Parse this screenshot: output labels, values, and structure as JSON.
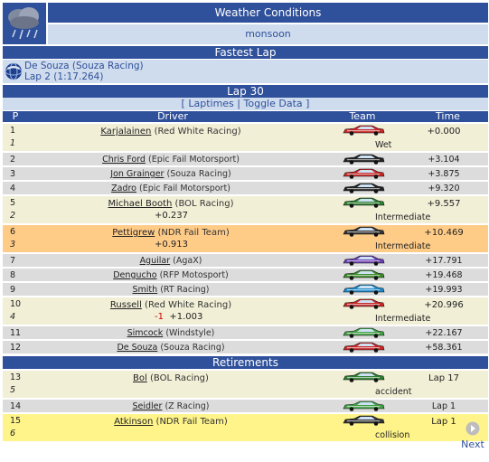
{
  "weather": {
    "title": "Weather Conditions",
    "value": "monsoon",
    "icon": "weather-cloud-rain-icon"
  },
  "fastest_lap": {
    "title": "Fastest Lap",
    "driver_line": "De Souza (Souza Racing)",
    "lap_line": "Lap 2 (1:17.264)",
    "icon": "globe-icon"
  },
  "lap": {
    "title": "Lap 30",
    "link_open": "[",
    "laptimes_label": "Laptimes",
    "separator": "|",
    "toggle_label": "Toggle Data",
    "link_close": "]"
  },
  "columns": {
    "p": "P",
    "driver": "Driver",
    "team": "Team",
    "time": "Time"
  },
  "standings": [
    {
      "pos": "1",
      "grid": "1",
      "driver": "Karjalainen",
      "team": "(Red White Racing)",
      "gain": "",
      "time": "+0.000",
      "cond": "Wet",
      "bg": "#f1efd6",
      "car": "#c62828"
    },
    {
      "pos": "2",
      "grid": "",
      "driver": "Chris Ford",
      "team": "(Epic Fail Motorsport)",
      "gain": "",
      "time": "+3.104",
      "cond": "",
      "bg": "#dcdcdc",
      "car": "#222222"
    },
    {
      "pos": "3",
      "grid": "",
      "driver": "Jon Grainger",
      "team": "(Souza Racing)",
      "gain": "",
      "time": "+3.875",
      "cond": "",
      "bg": "#dcdcdc",
      "car": "#c62828"
    },
    {
      "pos": "4",
      "grid": "",
      "driver": "Zadro",
      "team": "(Epic Fail Motorsport)",
      "gain": "",
      "time": "+9.320",
      "cond": "",
      "bg": "#dcdcdc",
      "car": "#222222"
    },
    {
      "pos": "5",
      "grid": "2",
      "driver": "Michael Booth",
      "team": "(BOL Racing)",
      "gain": "+0.237",
      "time": "+9.557",
      "cond": "Intermediate",
      "bg": "#f1efd6",
      "car": "#2e7d32"
    },
    {
      "pos": "6",
      "grid": "3",
      "driver": "Pettigrew",
      "team": "(NDR Fail Team)",
      "gain": "+0.913",
      "time": "+10.469",
      "cond": "Intermediate",
      "bg": "#ffcc88",
      "car": "#333333"
    },
    {
      "pos": "7",
      "grid": "",
      "driver": "Aguilar",
      "team": "(AgaX)",
      "gain": "",
      "time": "+17.791",
      "cond": "",
      "bg": "#dcdcdc",
      "car": "#6a3fb0"
    },
    {
      "pos": "8",
      "grid": "",
      "driver": "Dengucho",
      "team": "(RFP Motosport)",
      "gain": "",
      "time": "+19.468",
      "cond": "",
      "bg": "#dcdcdc",
      "car": "#3c8a2a"
    },
    {
      "pos": "9",
      "grid": "",
      "driver": "Smith",
      "team": "(RT Racing)",
      "gain": "",
      "time": "+19.993",
      "cond": "",
      "bg": "#dcdcdc",
      "car": "#1e88c8"
    },
    {
      "pos": "10",
      "grid": "4",
      "driver": "Russell",
      "team": "(Red White Racing)",
      "gain_neg": "-1",
      "gain": "+1.003",
      "time": "+20.996",
      "cond": "Intermediate",
      "bg": "#f1efd6",
      "car": "#c62828"
    },
    {
      "pos": "11",
      "grid": "",
      "driver": "Simcock",
      "team": "(Windstyle)",
      "gain": "",
      "time": "+22.167",
      "cond": "",
      "bg": "#dcdcdc",
      "car": "#43a047"
    },
    {
      "pos": "12",
      "grid": "",
      "driver": "De Souza",
      "team": "(Souza Racing)",
      "gain": "",
      "time": "+58.361",
      "cond": "",
      "bg": "#dcdcdc",
      "car": "#c62828"
    }
  ],
  "retirements_title": "Retirements",
  "retirements": [
    {
      "pos": "13",
      "grid": "5",
      "driver": "Bol",
      "team": "(BOL Racing)",
      "gain": "",
      "time": "Lap 17",
      "cond": "accident",
      "bg": "#f1efd6",
      "car": "#2e7d32"
    },
    {
      "pos": "14",
      "grid": "",
      "driver": "Seidler",
      "team": "(Z Racing)",
      "gain": "",
      "time": "Lap 1",
      "cond": "",
      "bg": "#dcdcdc",
      "car": "#43a047"
    },
    {
      "pos": "15",
      "grid": "6",
      "driver": "Atkinson",
      "team": "(NDR Fail Team)",
      "gain": "",
      "time": "Lap 1",
      "cond": "collision",
      "bg": "#fff48a",
      "car": "#333333"
    }
  ],
  "next": {
    "label": "Next",
    "icon": "arrow-right-circle-icon"
  }
}
